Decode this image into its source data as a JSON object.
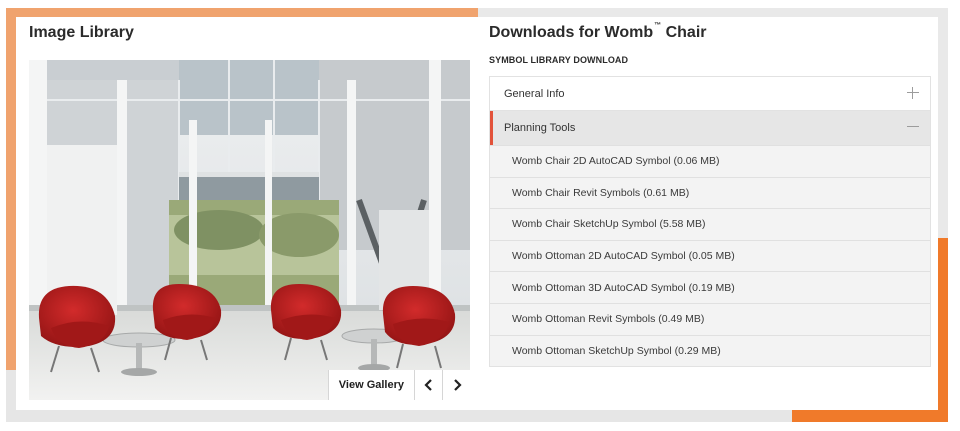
{
  "image_library": {
    "title": "Image Library",
    "view_gallery_label": "View Gallery",
    "prev_icon": "chevron-left-icon",
    "next_icon": "chevron-right-icon"
  },
  "downloads": {
    "title": "Downloads for Womb",
    "trademark": "™",
    "title_suffix": "Chair",
    "section_label": "SYMBOL LIBRARY DOWNLOAD",
    "general_info": {
      "label": "General Info",
      "toggle_icon": "plus-icon"
    },
    "planning_tools": {
      "label": "Planning Tools",
      "toggle_icon": "minus-icon",
      "accent_color": "#e2523a"
    },
    "items": [
      {
        "label": "Womb Chair 2D AutoCAD Symbol (0.06 MB)"
      },
      {
        "label": "Womb Chair Revit Symbols (0.61 MB)"
      },
      {
        "label": "Womb Chair SketchUp Symbol (5.58 MB)"
      },
      {
        "label": "Womb Ottoman 2D AutoCAD Symbol (0.05 MB)"
      },
      {
        "label": "Womb Ottoman 3D AutoCAD Symbol (0.19 MB)"
      },
      {
        "label": "Womb Ottoman Revit Symbols (0.49 MB)"
      },
      {
        "label": "Womb Ottoman SketchUp Symbol (0.29 MB)"
      }
    ]
  },
  "colors": {
    "frame_orange_light": "#f0a36e",
    "frame_orange": "#f07a2a",
    "frame_gray": "#e6e6e6"
  }
}
